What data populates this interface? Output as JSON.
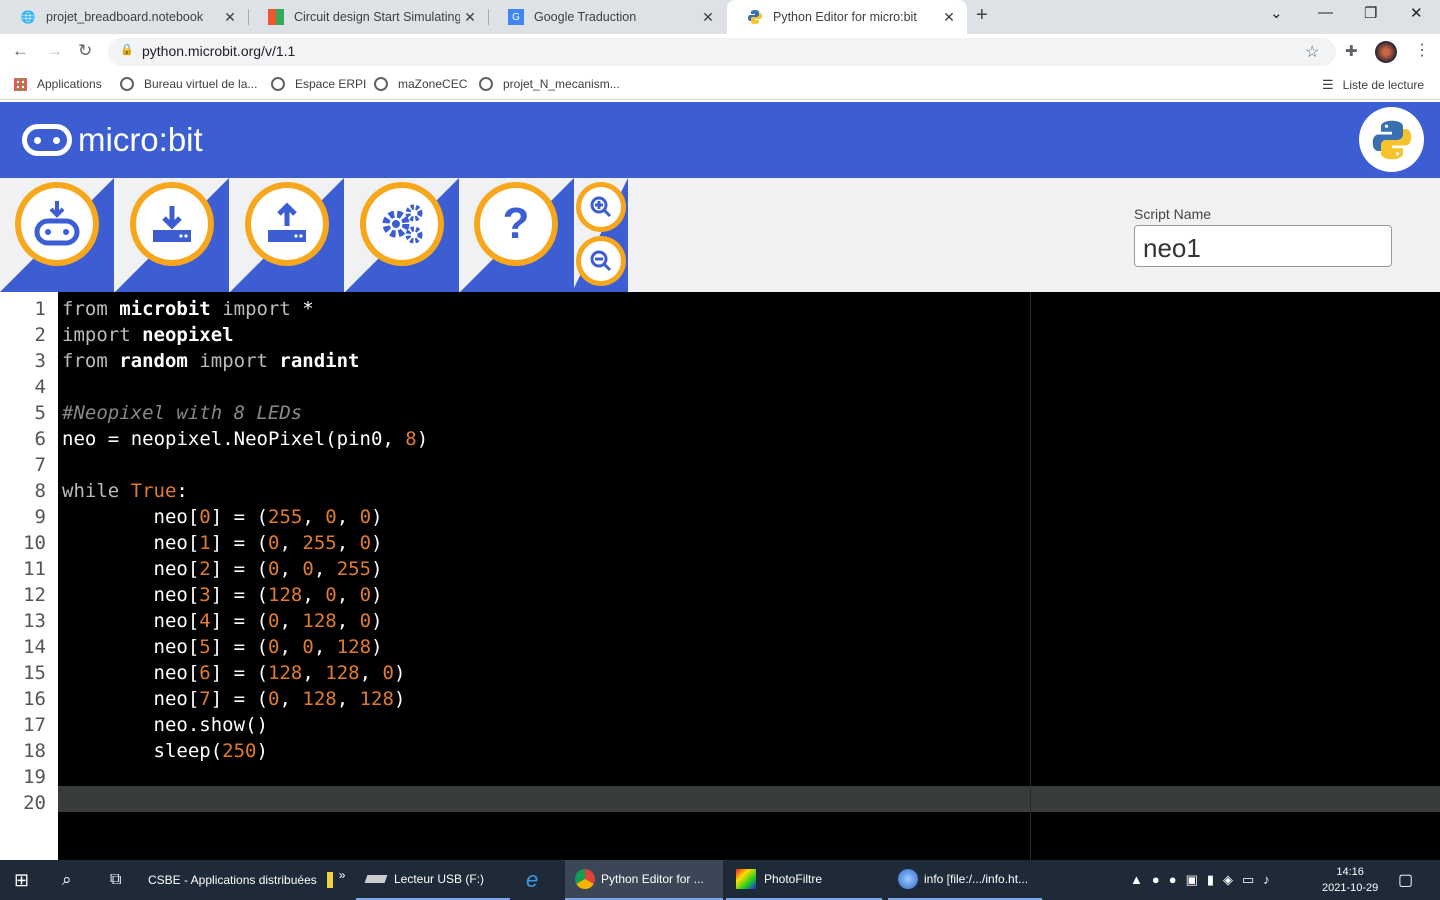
{
  "browser": {
    "tabs": [
      {
        "title": "projet_breadboard.notebook",
        "icon": "globe-icon"
      },
      {
        "title": "Circuit design Start Simulating | T",
        "icon": "tinkercad-icon"
      },
      {
        "title": "Google Traduction",
        "icon": "google-translate-icon"
      },
      {
        "title": "Python Editor for micro:bit",
        "icon": "python-icon",
        "active": true
      }
    ],
    "url": "python.microbit.org/v/1.1",
    "bookmarks": [
      "Applications",
      "Bureau virtuel de la...",
      "Espace ERPI",
      "maZoneCEC",
      "projet_N_mecanism..."
    ],
    "reading_list": "Liste de lecture"
  },
  "app": {
    "logo_text": "micro:bit",
    "tools": [
      {
        "label": "Download",
        "icon": "microbit-download-icon"
      },
      {
        "label": "Save",
        "icon": "save-icon"
      },
      {
        "label": "Load",
        "icon": "upload-icon"
      },
      {
        "label": "Snippets",
        "icon": "gears-icon"
      },
      {
        "label": "Help",
        "icon": "question-icon"
      }
    ],
    "script_name_label": "Script Name",
    "script_name": "neo1"
  },
  "editor": {
    "line_numbers": [
      "1",
      "2",
      "3",
      "4",
      "5",
      "6",
      "7",
      "8",
      "9",
      "10",
      "11",
      "12",
      "13",
      "14",
      "15",
      "16",
      "17",
      "18",
      "19",
      "20"
    ],
    "current_line": "20",
    "code": [
      "from microbit import *",
      "import neopixel",
      "from random import randint",
      "",
      "#Neopixel with 8 LEDs",
      "neo = neopixel.NeoPixel(pin0, 8)",
      "",
      "while True:",
      "        neo[0] = (255, 0, 0)",
      "        neo[1] = (0, 255, 0)",
      "        neo[2] = (0, 0, 255)",
      "        neo[3] = (128, 0, 0)",
      "        neo[4] = (0, 128, 0)",
      "        neo[5] = (0, 0, 128)",
      "        neo[6] = (128, 128, 0)",
      "        neo[7] = (0, 128, 128)",
      "        neo.show()",
      "        sleep(250)",
      "",
      ""
    ]
  },
  "taskbar": {
    "items": [
      "CSBE - Applications distribuées",
      "Lecteur USB (F:)",
      "Python Editor for ...",
      "PhotoFiltre",
      "info [file:/.../info.ht..."
    ],
    "time": "14:16",
    "date": "2021-10-29"
  },
  "colors": {
    "brand_blue": "#3d5ed3",
    "brand_orange": "#f7a71c",
    "editor_bg": "#000000"
  }
}
